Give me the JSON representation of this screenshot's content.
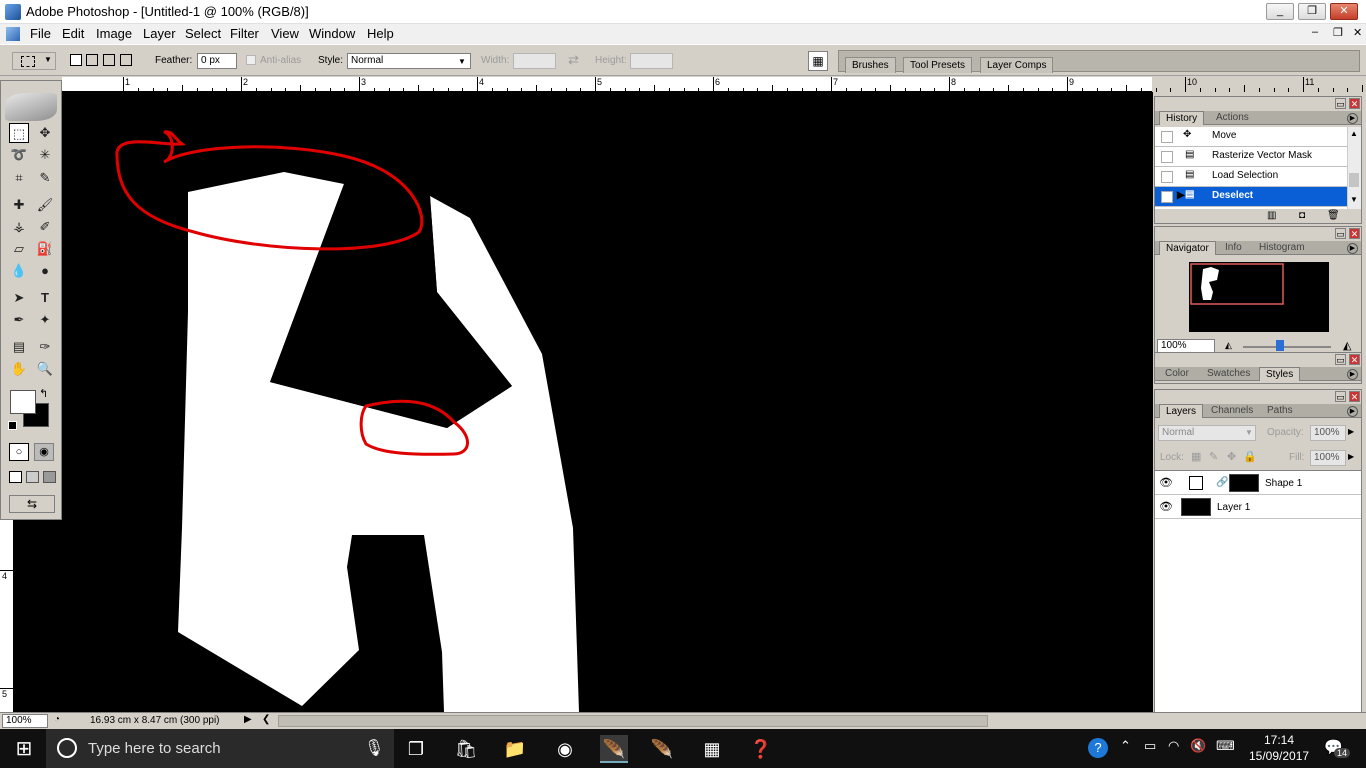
{
  "window": {
    "title": "Adobe Photoshop - [Untitled-1 @ 100% (RGB/8)]",
    "minimize": "_",
    "restore": "❐",
    "close": "✕"
  },
  "menu": [
    "File",
    "Edit",
    "Image",
    "Layer",
    "Select",
    "Filter",
    "View",
    "Window",
    "Help"
  ],
  "options": {
    "feather_label": "Feather:",
    "feather_value": "0 px",
    "antialias_label": "Anti-alias",
    "style_label": "Style:",
    "style_value": "Normal",
    "width_label": "Width:",
    "height_label": "Height:"
  },
  "wells": [
    "Brushes",
    "Tool Presets",
    "Layer Comps"
  ],
  "ruler": {
    "h_numbers": [
      "1",
      "2",
      "3",
      "4",
      "5",
      "6",
      "7",
      "8",
      "9",
      "10",
      "11"
    ],
    "v_numbers": [
      "4",
      "5"
    ]
  },
  "history": {
    "tabs": [
      "History",
      "Actions"
    ],
    "items": [
      "Move",
      "Rasterize Vector Mask",
      "Load Selection",
      "Deselect"
    ]
  },
  "navigator": {
    "tabs": [
      "Navigator",
      "Info",
      "Histogram"
    ],
    "zoom": "100%"
  },
  "color_panel": {
    "tabs": [
      "Color",
      "Swatches",
      "Styles"
    ]
  },
  "layers": {
    "tabs": [
      "Layers",
      "Channels",
      "Paths"
    ],
    "blend_mode": "Normal",
    "opacity_label": "Opacity:",
    "opacity_value": "100%",
    "lock_label": "Lock:",
    "fill_label": "Fill:",
    "fill_value": "100%",
    "items": [
      "Shape 1",
      "Layer 1"
    ]
  },
  "status": {
    "zoom": "100%",
    "doc_info": "16.93 cm x 8.47 cm (300 ppi)"
  },
  "taskbar": {
    "search_placeholder": "Type here to search",
    "time": "17:14",
    "date": "15/09/2017",
    "notifications": "14"
  },
  "colors": {
    "accent": "#0a5fd6",
    "annotation": "#e00000",
    "canvas": "#000000"
  }
}
